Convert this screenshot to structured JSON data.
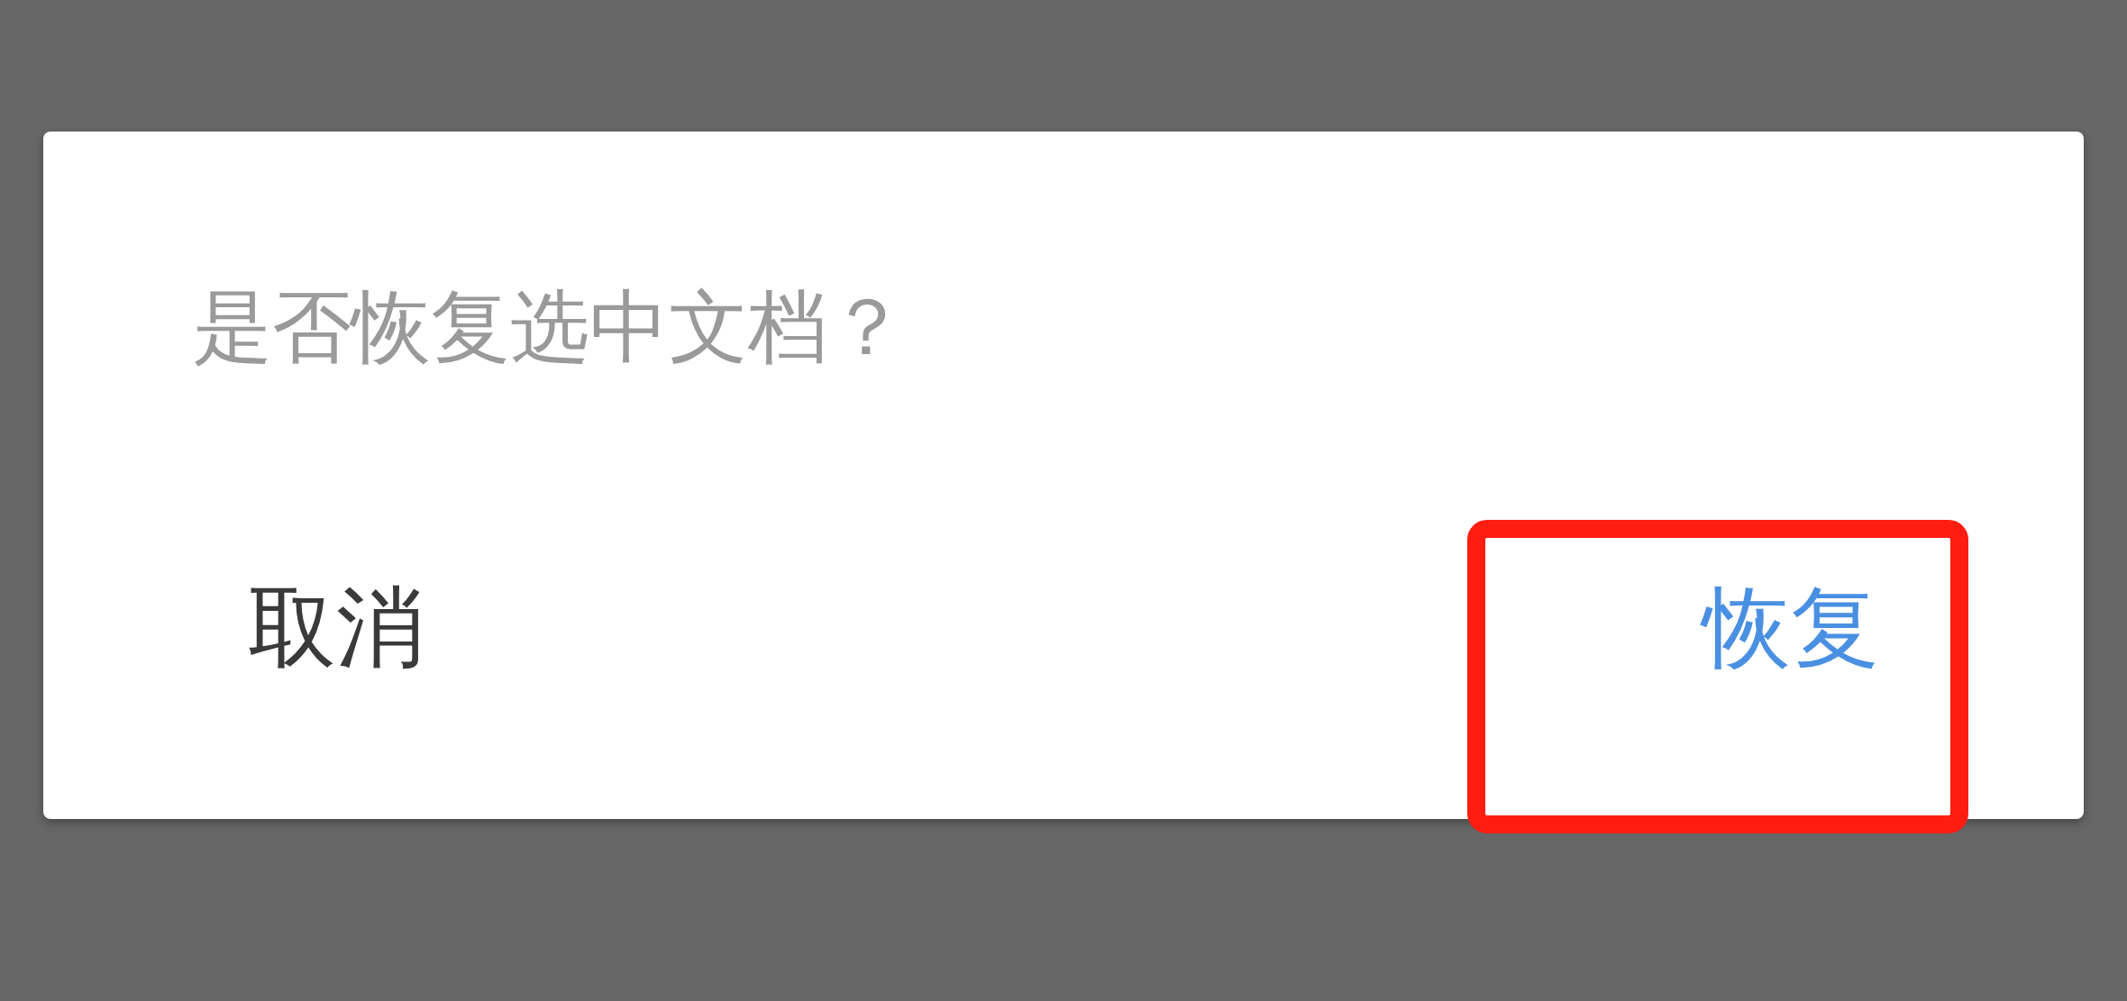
{
  "dialog": {
    "message": "是否恢复选中文档？",
    "buttons": [
      {
        "kind": "neutral",
        "label": "取消",
        "highlighted": false
      },
      {
        "kind": "primary",
        "label": "恢复",
        "highlighted": true
      }
    ]
  }
}
